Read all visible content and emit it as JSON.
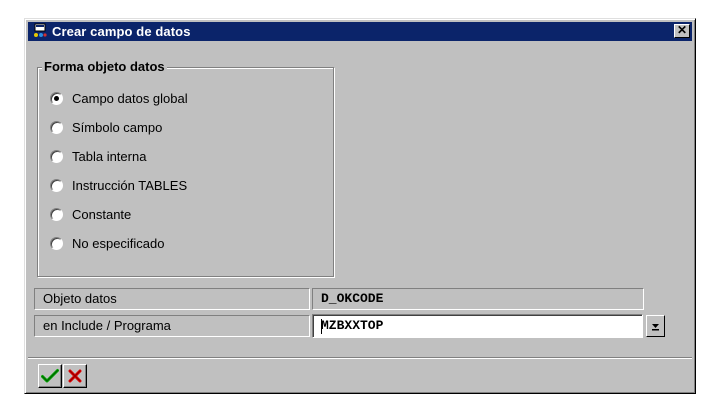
{
  "dialog": {
    "title": "Crear campo de datos",
    "close_glyph": "✕",
    "icon": "sap-window-icon"
  },
  "group": {
    "legend": "Forma objeto datos",
    "options": [
      {
        "label": "Campo datos global",
        "checked": true
      },
      {
        "label": "Símbolo campo",
        "checked": false
      },
      {
        "label": "Tabla interna",
        "checked": false
      },
      {
        "label": "Instrucción TABLES",
        "checked": false
      },
      {
        "label": "Constante",
        "checked": false
      },
      {
        "label": "No especificado",
        "checked": false
      }
    ]
  },
  "fields": {
    "objeto_label": "Objeto datos",
    "objeto_value": "D_OKCODE",
    "include_label": "en Include / Programa",
    "include_value": "MZBXXTOP"
  },
  "buttons": {
    "confirm_icon": "checkmark-icon",
    "cancel_icon": "cancel-x-icon"
  },
  "colors": {
    "title_bar": "#0b246a",
    "dialog_bg": "#c0c0c0",
    "confirm": "#00a000",
    "cancel": "#e00000"
  }
}
